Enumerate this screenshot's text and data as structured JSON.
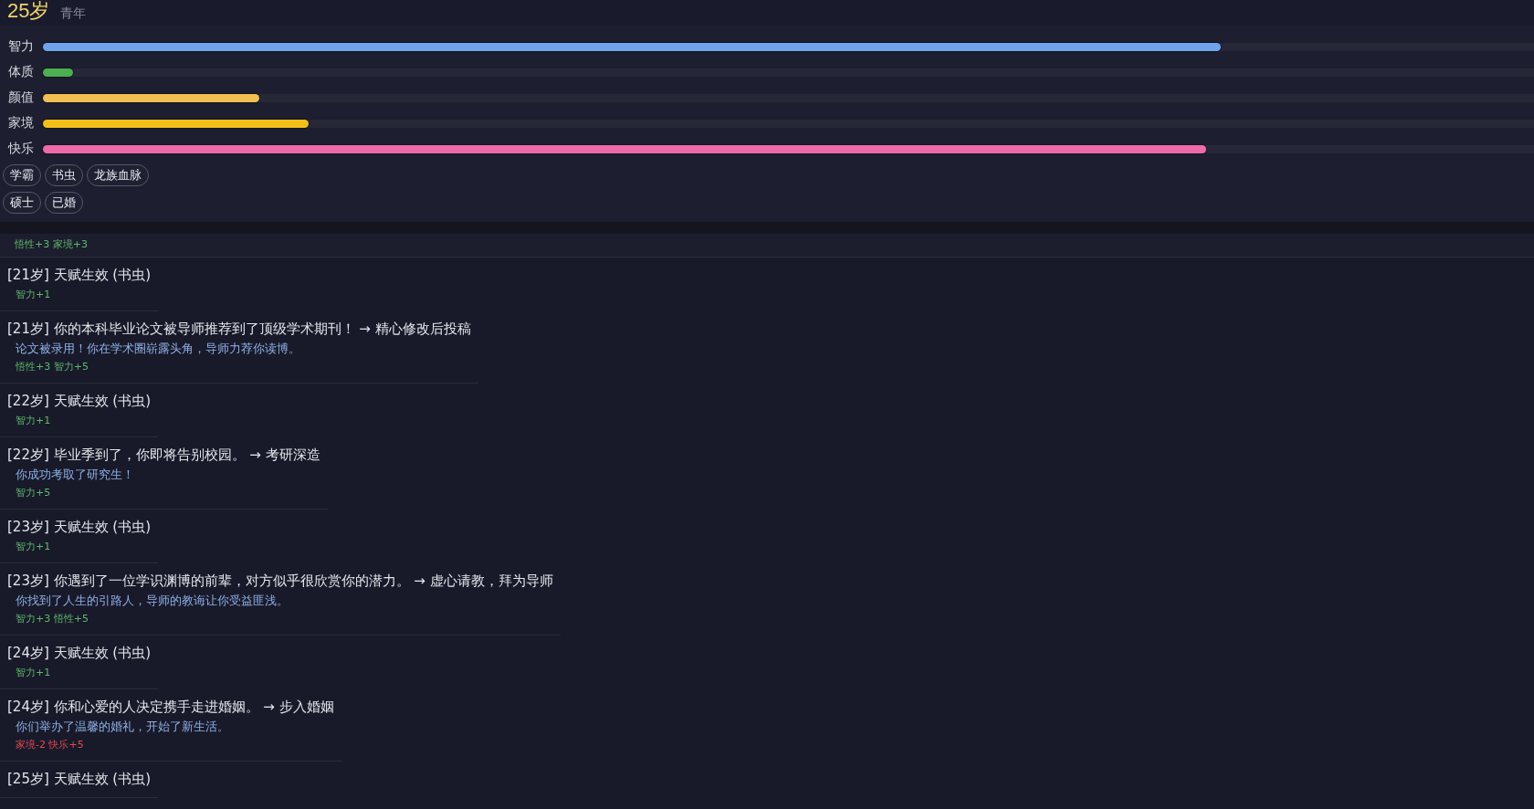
{
  "header": {
    "age": "25岁",
    "stage": "青年"
  },
  "stats": [
    {
      "label": "智力",
      "level": 0.79,
      "color": "#6fa4ec"
    },
    {
      "label": "体质",
      "level": 0.02,
      "color": "#4caf50"
    },
    {
      "label": "颜值",
      "level": 0.145,
      "color": "#f0c050"
    },
    {
      "label": "家境",
      "level": 0.178,
      "color": "#f2c019"
    },
    {
      "label": "快乐",
      "level": 0.78,
      "color": "#f06aaa"
    }
  ],
  "tag_rows": [
    [
      "学霸",
      "书虫",
      "龙族血脉"
    ],
    [
      "硕士",
      "已婚"
    ]
  ],
  "log": [
    {
      "effects": "悟性+3 家境+3",
      "color": "#5fb86a"
    },
    {
      "title": "[21岁] 天赋生效 (书虫)",
      "effects": "智力+1",
      "color": "#5fb86a"
    },
    {
      "title": "[21岁] 你的本科毕业论文被导师推荐到了顶级学术期刊！ → 精心修改后投稿",
      "outcome": "论文被录用！你在学术圈崭露头角，导师力荐你读博。",
      "effects": "悟性+3 智力+5",
      "color": "#5fb86a"
    },
    {
      "title": "[22岁] 天赋生效 (书虫)",
      "effects": "智力+1",
      "color": "#5fb86a"
    },
    {
      "title": "[22岁] 毕业季到了，你即将告别校园。 → 考研深造",
      "outcome": "你成功考取了研究生！",
      "effects": "智力+5",
      "color": "#5fb86a"
    },
    {
      "title": "[23岁] 天赋生效 (书虫)",
      "effects": "智力+1",
      "color": "#5fb86a"
    },
    {
      "title": "[23岁] 你遇到了一位学识渊博的前辈，对方似乎很欣赏你的潜力。 → 虚心请教，拜为导师",
      "outcome": "你找到了人生的引路人，导师的教诲让你受益匪浅。",
      "effects": "智力+3 悟性+5",
      "color": "#5fb86a"
    },
    {
      "title": "[24岁] 天赋生效 (书虫)",
      "effects": "智力+1",
      "color": "#5fb86a"
    },
    {
      "title": "[24岁] 你和心爱的人决定携手走进婚姻。 → 步入婚姻",
      "outcome": "你们举办了温馨的婚礼，开始了新生活。",
      "effects": "家境-2 快乐+5",
      "color": "#e5484d"
    },
    {
      "title": "[25岁] 天赋生效 (书虫)"
    }
  ]
}
